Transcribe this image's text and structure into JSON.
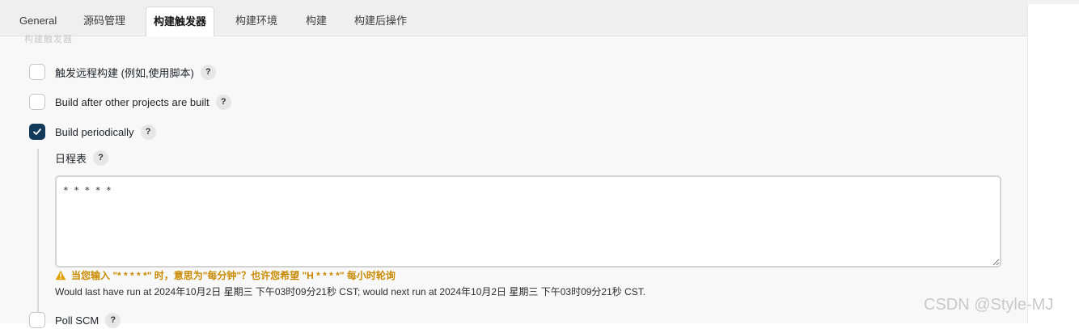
{
  "tabs": [
    {
      "label": "General"
    },
    {
      "label": "源码管理"
    },
    {
      "label": "构建触发器",
      "active": true
    },
    {
      "label": "构建环境"
    },
    {
      "label": "构建"
    },
    {
      "label": "构建后操作"
    }
  ],
  "section_heading_fragment": "构建触发器",
  "triggers": {
    "remote": {
      "label": "触发远程构建 (例如,使用脚本)",
      "checked": false
    },
    "after_other": {
      "label": "Build after other projects are built",
      "checked": false
    },
    "periodically": {
      "label": "Build periodically",
      "checked": true
    },
    "poll_scm": {
      "label": "Poll SCM",
      "checked": false
    }
  },
  "help_symbol": "?",
  "schedule": {
    "label": "日程表",
    "value": "* * * * *",
    "warning": "当您输入 \"* * * * *\" 时，意思为\"每分钟\"？也许您希望 \"H * * * *\" 每小时轮询",
    "info": "Would last have run at 2024年10月2日 星期三 下午03时09分21秒 CST; would next run at 2024年10月2日 星期三 下午03时09分21秒 CST."
  },
  "watermark": "CSDN @Style-MJ",
  "colors": {
    "checked": "#11395a",
    "warning": "#c98a00",
    "panel": "#f8f8f8"
  }
}
